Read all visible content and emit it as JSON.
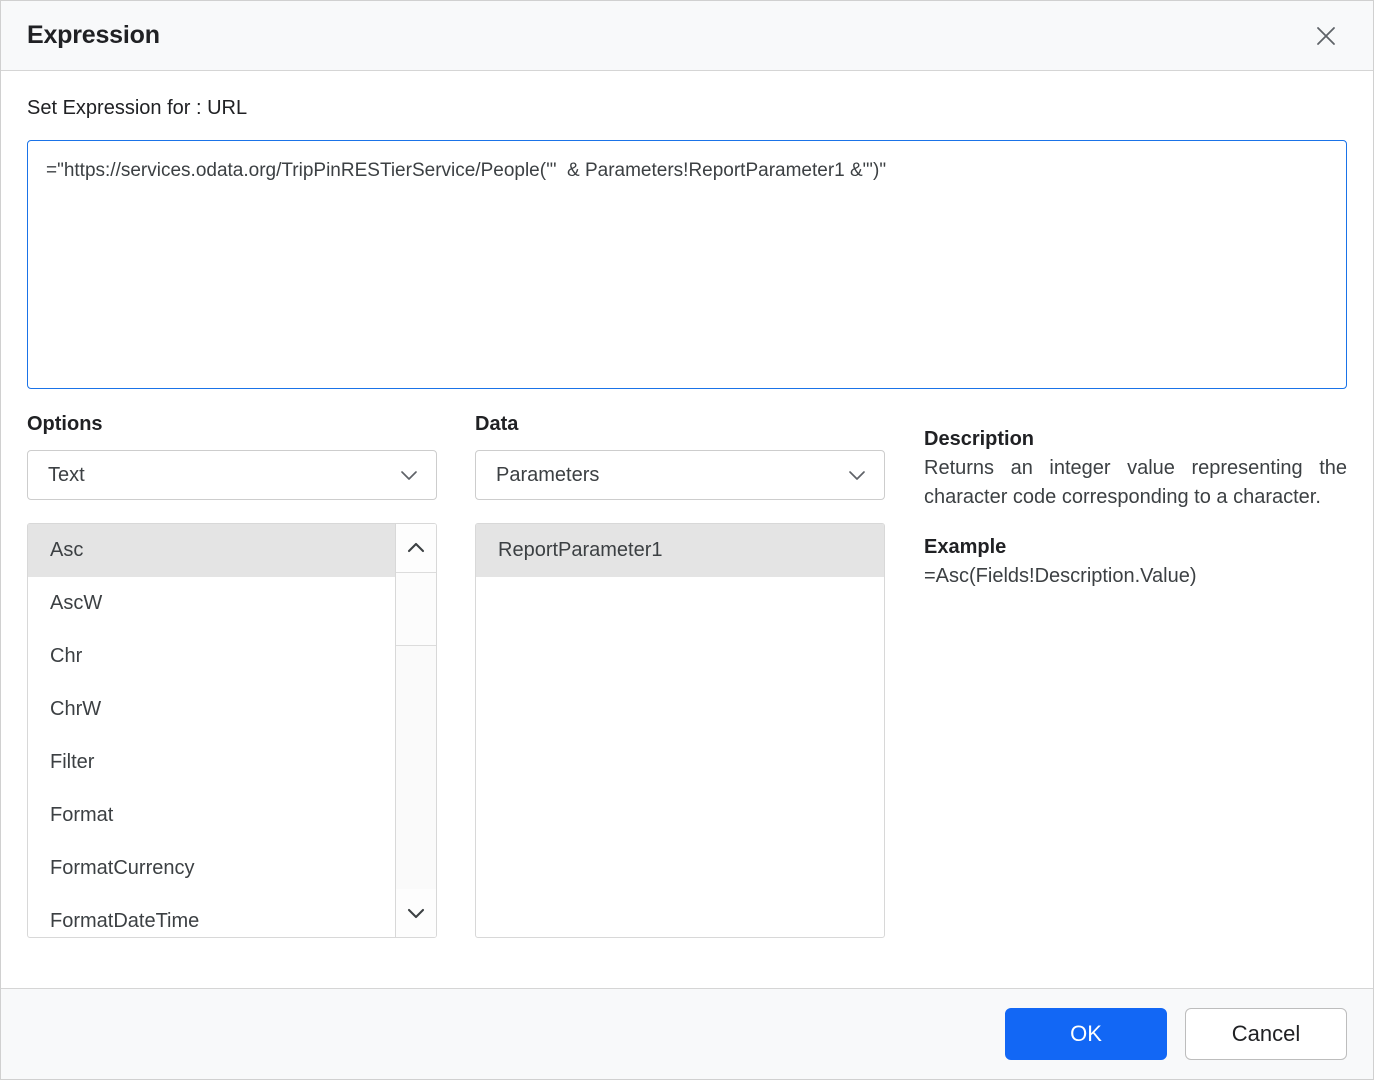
{
  "dialog": {
    "title": "Expression",
    "close_icon": "close-icon"
  },
  "expression": {
    "label": "Set Expression for : URL",
    "value": "=\"https://services.odata.org/TripPinRESTierService/People('\"  & Parameters!ReportParameter1 &\"')\"",
    "placeholder": "Enter expression"
  },
  "options": {
    "label": "Options",
    "selected": "Text",
    "dropdown_icon": "chevron-down-icon",
    "functions": [
      "Asc",
      "AscW",
      "Chr",
      "ChrW",
      "Filter",
      "Format",
      "FormatCurrency",
      "FormatDateTime"
    ],
    "selected_function": "Asc",
    "scroll_up_icon": "chevron-up-icon",
    "scroll_down_icon": "chevron-down-icon"
  },
  "data": {
    "label": "Data",
    "selected": "Parameters",
    "dropdown_icon": "chevron-down-icon",
    "items": [
      "ReportParameter1"
    ],
    "selected_item": "ReportParameter1"
  },
  "description": {
    "heading": "Description",
    "text": "Returns an integer value representing the character code corresponding to a character.",
    "example_heading": "Example",
    "example_text": "=Asc(Fields!Description.Value)"
  },
  "footer": {
    "ok_label": "OK",
    "cancel_label": "Cancel"
  },
  "colors": {
    "accent": "#1267f5",
    "focus_border": "#1a73e8",
    "selected_row": "#e4e4e4",
    "header_bg": "#f8f9fa"
  }
}
